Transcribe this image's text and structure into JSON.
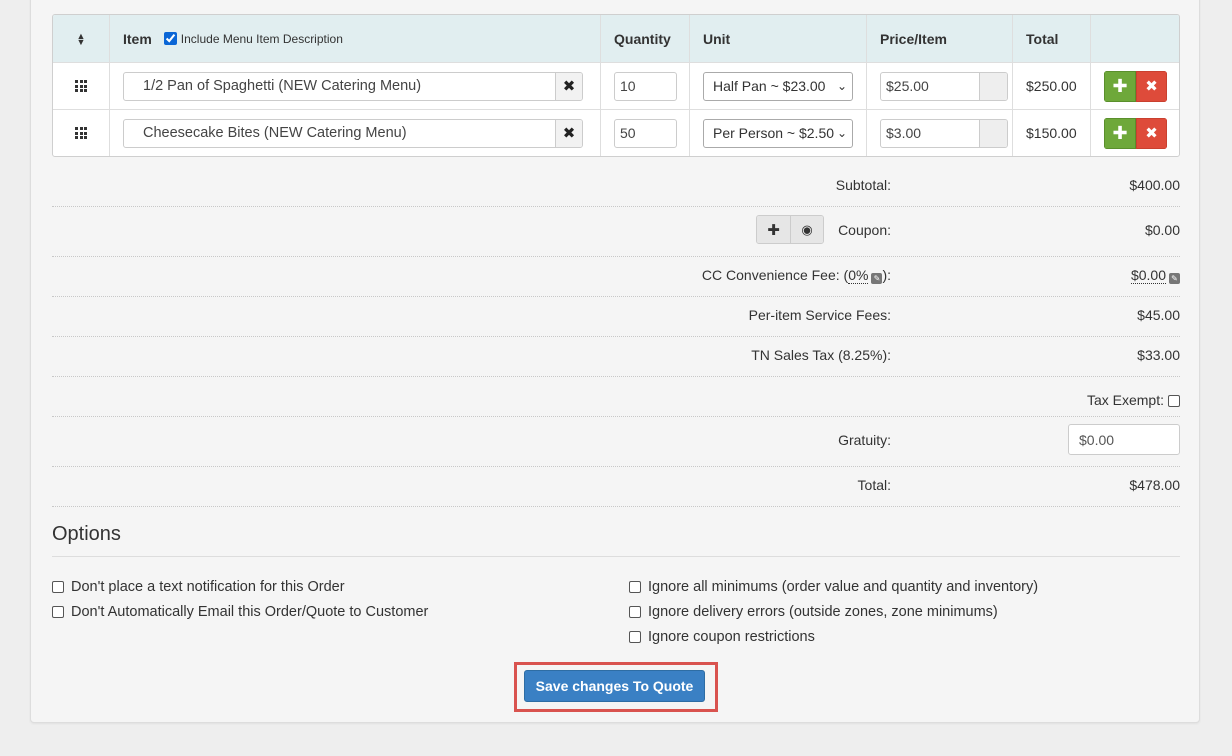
{
  "table": {
    "headers": {
      "item": "Item",
      "include_desc": "Include Menu Item Description",
      "include_desc_checked": true,
      "quantity": "Quantity",
      "unit": "Unit",
      "price": "Price/Item",
      "total": "Total"
    },
    "rows": [
      {
        "item": "1/2 Pan of Spaghetti (NEW Catering Menu)",
        "quantity": "10",
        "unit": "Half Pan ~ $23.00",
        "price": "$25.00",
        "total": "$250.00"
      },
      {
        "item": "Cheesecake Bites (NEW Catering Menu)",
        "quantity": "50",
        "unit": "Per Person ~ $2.50",
        "price": "$3.00",
        "total": "$150.00"
      }
    ]
  },
  "summary": {
    "subtotal_label": "Subtotal:",
    "subtotal_value": "$400.00",
    "coupon_label": "Coupon:",
    "coupon_value": "$0.00",
    "cc_fee_label_pre": "CC Convenience Fee: (",
    "cc_fee_percent": "0%",
    "cc_fee_label_post": "):",
    "cc_fee_value": "$0.00",
    "service_fee_label": "Per-item Service Fees:",
    "service_fee_value": "$45.00",
    "tax_label": "TN Sales Tax (8.25%):",
    "tax_value": "$33.00",
    "tax_exempt_label": "Tax Exempt:",
    "gratuity_label": "Gratuity:",
    "gratuity_value": "$0.00",
    "total_label": "Total:",
    "total_value": "$478.00"
  },
  "options": {
    "title": "Options",
    "left": [
      "Don't place a text notification for this Order",
      "Don't Automatically Email this Order/Quote to Customer"
    ],
    "right": [
      "Ignore all minimums (order value and quantity and inventory)",
      "Ignore delivery errors (outside zones, zone minimums)",
      "Ignore coupon restrictions"
    ]
  },
  "save_button": "Save changes To Quote",
  "colors": {
    "header_bg": "#e1eef0",
    "add_green": "#6ea83a",
    "delete_red": "#de4b3a",
    "primary_blue": "#3a80c4",
    "highlight_red": "#d9534f"
  }
}
